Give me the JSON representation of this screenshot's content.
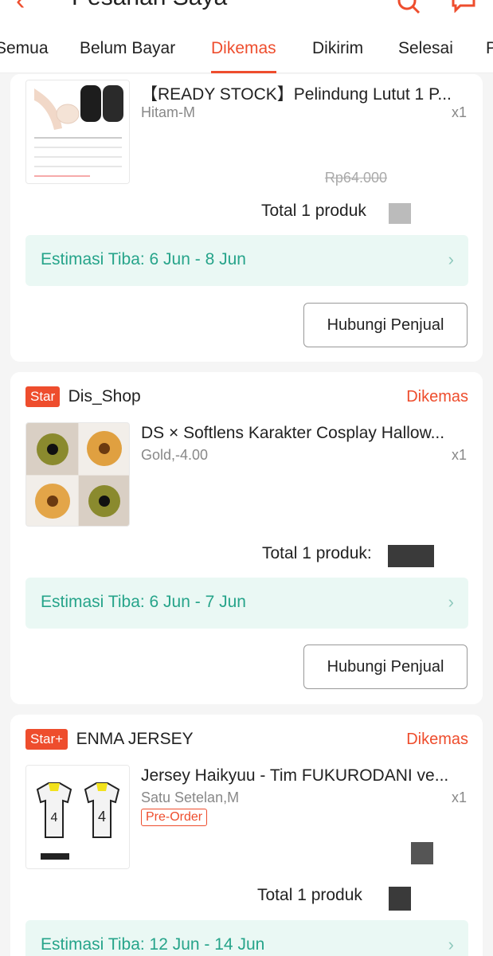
{
  "header": {
    "back_icon": "back-arrow-icon",
    "title": "Pesanan Saya",
    "search_icon": "search-icon",
    "chat_icon": "chat-icon"
  },
  "tabs": [
    {
      "label": "Semua",
      "active": false
    },
    {
      "label": "Belum Bayar",
      "active": false
    },
    {
      "label": "Dikemas",
      "active": true
    },
    {
      "label": "Dikirim",
      "active": false
    },
    {
      "label": "Selesai",
      "active": false
    },
    {
      "label": "P",
      "active": false
    }
  ],
  "orders": [
    {
      "product_name": "【READY STOCK】Pelindung Lutut 1 P...",
      "variant": "Hitam-M",
      "qty": "x1",
      "old_price": "Rp64.000",
      "total_label": "Total 1 produk",
      "eta": "Estimasi Tiba: 6 Jun - 8 Jun",
      "action": "Hubungi Penjual"
    },
    {
      "badge": "Star",
      "shop": "Dis_Shop",
      "status": "Dikemas",
      "product_name": "DS × Softlens Karakter Cosplay Hallow...",
      "variant": "Gold,-4.00",
      "qty": "x1",
      "total_label": "Total 1 produk:",
      "eta": "Estimasi Tiba: 6 Jun - 7 Jun",
      "action": "Hubungi Penjual"
    },
    {
      "badge": "Star+",
      "shop": "ENMA JERSEY",
      "status": "Dikemas",
      "product_name": "Jersey Haikyuu - Tim FUKURODANI ve...",
      "variant": "Satu Setelan,M",
      "qty": "x1",
      "tag": "Pre-Order",
      "total_label": "Total 1 produk",
      "eta": "Estimasi Tiba: 12 Jun - 14 Jun"
    }
  ],
  "colors": {
    "brand": "#ee4d2d",
    "eta_text": "#26a48a",
    "eta_bg": "#eaf8f4"
  }
}
